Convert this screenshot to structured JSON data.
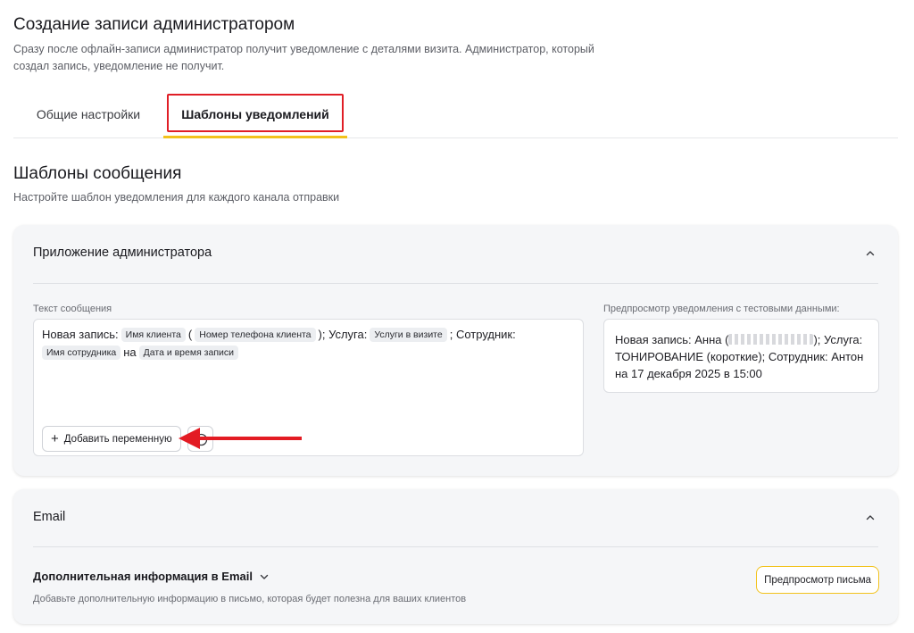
{
  "header": {
    "title": "Создание записи администратором",
    "description": "Сразу после офлайн-записи администратор получит уведомление с деталями визита. Администратор, который создал запись, уведомление не получит."
  },
  "tabs": [
    {
      "label": "Общие настройки",
      "active": false
    },
    {
      "label": "Шаблоны уведомлений",
      "active": true
    }
  ],
  "templates": {
    "title": "Шаблоны сообщения",
    "description": "Настройте шаблон уведомления для каждого канала отправки"
  },
  "admin_app": {
    "title": "Приложение администратора",
    "message_label": "Текст сообщения",
    "message": {
      "t1": "Новая запись:",
      "var_client": "Имя клиента",
      "t2": "(",
      "var_phone": "Номер телефона клиента",
      "t3": "); Услуга:",
      "var_services": "Услуги в визите",
      "t4": "; Сотрудник:",
      "var_employee": "Имя сотрудника",
      "t5": "на",
      "var_datetime": "Дата и время записи"
    },
    "add_variable_label": "Добавить переменную",
    "preview_label": "Предпросмотр уведомления с тестовыми данными:",
    "preview": {
      "p1": "Новая запись: Анна (",
      "p2": "); Услуга: ТОНИРОВАНИЕ (короткие); Сотрудник: Антон на 17 декабря 2025 в 15:00"
    }
  },
  "email": {
    "title": "Email",
    "extra_info_title": "Дополнительная информация в Email",
    "extra_info_desc": "Добавьте дополнительную информацию в письмо, которая будет полезна для ваших клиентов",
    "preview_button": "Предпросмотр письма"
  },
  "colors": {
    "accent": "#f2c21b",
    "highlight": "#e01e26",
    "arrow": "#e31b23"
  },
  "icons": [
    "chevron-up-icon",
    "chevron-down-icon",
    "plus-icon",
    "emoji-icon",
    "arrow-left-icon"
  ]
}
